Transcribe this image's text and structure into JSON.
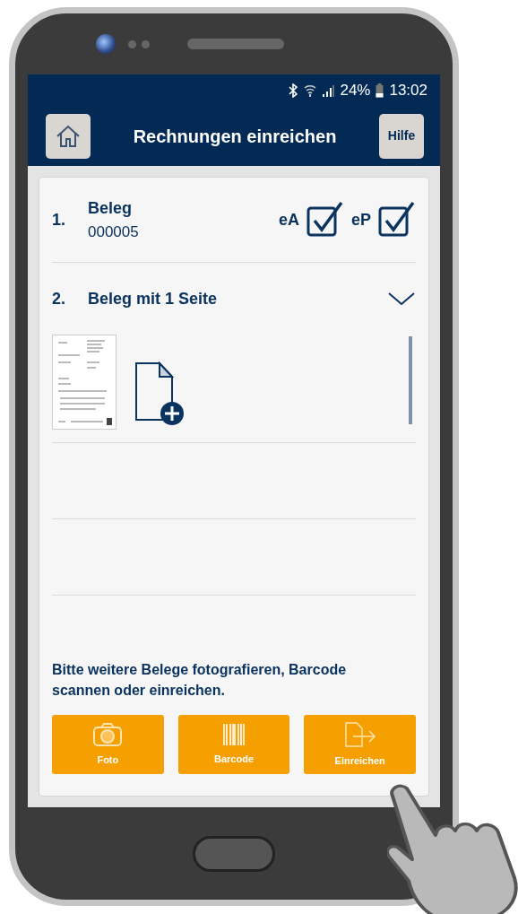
{
  "status_bar": {
    "battery": "24%",
    "time": "13:02"
  },
  "header": {
    "title": "Rechnungen einreichen",
    "help_button": "Hilfe"
  },
  "documents": [
    {
      "number": "1.",
      "title": "Beleg",
      "subtitle": "000005",
      "flags": [
        {
          "label": "eA",
          "checked": true
        },
        {
          "label": "eP",
          "checked": true
        }
      ]
    },
    {
      "number": "2.",
      "title": "Beleg mit 1 Seite",
      "expanded": true
    }
  ],
  "message": "Bitte weitere Belege fotografieren, Barcode scannen oder einreichen.",
  "actions": [
    {
      "kind": "photo",
      "label": "Foto"
    },
    {
      "kind": "barcode",
      "label": "Barcode"
    },
    {
      "kind": "submit",
      "label": "Einreichen"
    }
  ]
}
